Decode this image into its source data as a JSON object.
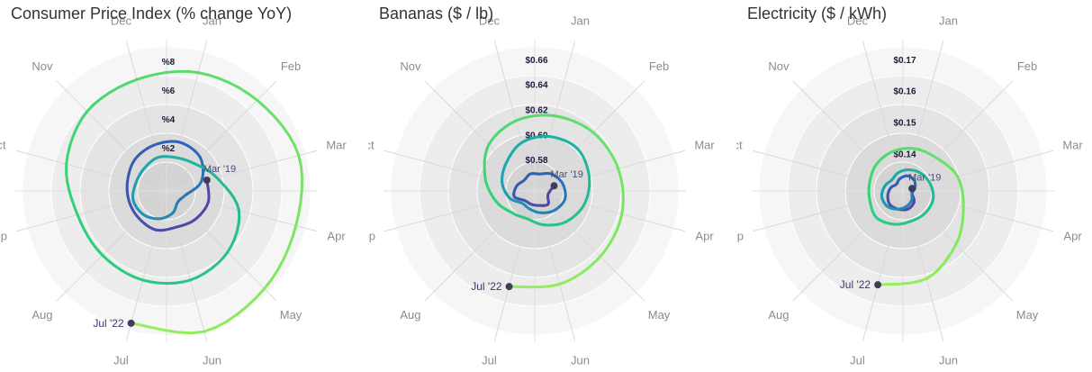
{
  "months": [
    "Jan",
    "Feb",
    "Mar",
    "Apr",
    "May",
    "Jun",
    "Jul",
    "Aug",
    "Sep",
    "Oct",
    "Nov",
    "Dec"
  ],
  "colors": {
    "start": "#5b3fa0",
    "mid1": "#2e62b8",
    "mid2": "#1aa6b0",
    "mid3": "#2fd07a",
    "end": "#9aef5a",
    "ring": "#efefef",
    "dot": "#3d3d5c"
  },
  "chart_data": [
    {
      "type": "line",
      "polar": true,
      "title": "Consumer Price Index (% change YoY)",
      "ticks": [
        "%2",
        "%4",
        "%6",
        "%8"
      ],
      "tick_values": [
        2,
        4,
        6,
        8
      ],
      "rmin": -1,
      "rmax": 9,
      "start_label": "Mar '19",
      "end_label": "Jul '22",
      "series": [
        {
          "x": [
            "2019-03",
            "2019-04",
            "2019-05",
            "2019-06",
            "2019-07",
            "2019-08",
            "2019-09",
            "2019-10",
            "2019-11",
            "2019-12",
            "2020-01",
            "2020-02",
            "2020-03",
            "2020-04",
            "2020-05",
            "2020-06",
            "2020-07",
            "2020-08",
            "2020-09",
            "2020-10",
            "2020-11",
            "2020-12",
            "2021-01",
            "2021-02",
            "2021-03",
            "2021-04",
            "2021-05",
            "2021-06",
            "2021-07",
            "2021-08",
            "2021-09",
            "2021-10",
            "2021-11",
            "2021-12",
            "2022-01",
            "2022-02",
            "2022-03",
            "2022-04",
            "2022-05",
            "2022-06",
            "2022-07"
          ],
          "values": [
            1.9,
            2.0,
            1.8,
            1.6,
            1.8,
            1.7,
            1.7,
            1.8,
            2.1,
            2.3,
            2.5,
            2.3,
            1.5,
            0.3,
            0.1,
            0.6,
            1.0,
            1.3,
            1.4,
            1.2,
            1.2,
            1.4,
            1.4,
            1.7,
            2.6,
            4.2,
            5.0,
            5.4,
            5.4,
            5.3,
            5.4,
            6.2,
            6.8,
            7.0,
            7.5,
            7.9,
            8.5,
            8.3,
            8.6,
            9.1,
            8.5
          ]
        }
      ]
    },
    {
      "type": "line",
      "polar": true,
      "title": "Bananas ($ / lb)",
      "ticks": [
        "$0.58",
        "$0.60",
        "$0.62",
        "$0.64",
        "$0.66"
      ],
      "tick_values": [
        0.58,
        0.6,
        0.62,
        0.64,
        0.66
      ],
      "rmin": 0.555,
      "rmax": 0.67,
      "start_label": "Mar '19",
      "end_label": "Jul '22",
      "series": [
        {
          "x": [
            "2019-03",
            "2019-04",
            "2019-05",
            "2019-06",
            "2019-07",
            "2019-08",
            "2019-09",
            "2019-10",
            "2019-11",
            "2019-12",
            "2020-01",
            "2020-02",
            "2020-03",
            "2020-04",
            "2020-05",
            "2020-06",
            "2020-07",
            "2020-08",
            "2020-09",
            "2020-10",
            "2020-11",
            "2020-12",
            "2021-01",
            "2021-02",
            "2021-03",
            "2021-04",
            "2021-05",
            "2021-06",
            "2021-07",
            "2021-08",
            "2021-09",
            "2021-10",
            "2021-11",
            "2021-12",
            "2022-01",
            "2022-02",
            "2022-03",
            "2022-04",
            "2022-05",
            "2022-06",
            "2022-07"
          ],
          "values": [
            0.571,
            0.566,
            0.57,
            0.567,
            0.566,
            0.566,
            0.572,
            0.57,
            0.567,
            0.569,
            0.569,
            0.574,
            0.578,
            0.58,
            0.577,
            0.573,
            0.57,
            0.569,
            0.576,
            0.582,
            0.587,
            0.595,
            0.6,
            0.603,
            0.6,
            0.596,
            0.59,
            0.583,
            0.578,
            0.58,
            0.587,
            0.596,
            0.607,
            0.613,
            0.617,
            0.621,
            0.624,
            0.627,
            0.629,
            0.632,
            0.634
          ]
        }
      ]
    },
    {
      "type": "line",
      "polar": true,
      "title": "Electricity ($ / kWh)",
      "ticks": [
        "$0.14",
        "$0.15",
        "$0.16",
        "$0.17"
      ],
      "tick_values": [
        0.14,
        0.15,
        0.16,
        0.17
      ],
      "rmin": 0.128,
      "rmax": 0.174,
      "start_label": "Mar '19",
      "end_label": "Jul '22",
      "series": [
        {
          "x": [
            "2019-03",
            "2019-04",
            "2019-05",
            "2019-06",
            "2019-07",
            "2019-08",
            "2019-09",
            "2019-10",
            "2019-11",
            "2019-12",
            "2020-01",
            "2020-02",
            "2020-03",
            "2020-04",
            "2020-05",
            "2020-06",
            "2020-07",
            "2020-08",
            "2020-09",
            "2020-10",
            "2020-11",
            "2020-12",
            "2021-01",
            "2021-02",
            "2021-03",
            "2021-04",
            "2021-05",
            "2021-06",
            "2021-07",
            "2021-08",
            "2021-09",
            "2021-10",
            "2021-11",
            "2021-12",
            "2022-01",
            "2022-02",
            "2022-03",
            "2022-04",
            "2022-05",
            "2022-06",
            "2022-07"
          ],
          "values": [
            0.131,
            0.131,
            0.133,
            0.134,
            0.134,
            0.134,
            0.133,
            0.132,
            0.131,
            0.132,
            0.133,
            0.133,
            0.132,
            0.131,
            0.132,
            0.133,
            0.134,
            0.135,
            0.135,
            0.134,
            0.133,
            0.134,
            0.135,
            0.136,
            0.137,
            0.138,
            0.138,
            0.138,
            0.139,
            0.14,
            0.139,
            0.139,
            0.14,
            0.141,
            0.142,
            0.143,
            0.146,
            0.148,
            0.152,
            0.157,
            0.159
          ]
        }
      ]
    }
  ]
}
